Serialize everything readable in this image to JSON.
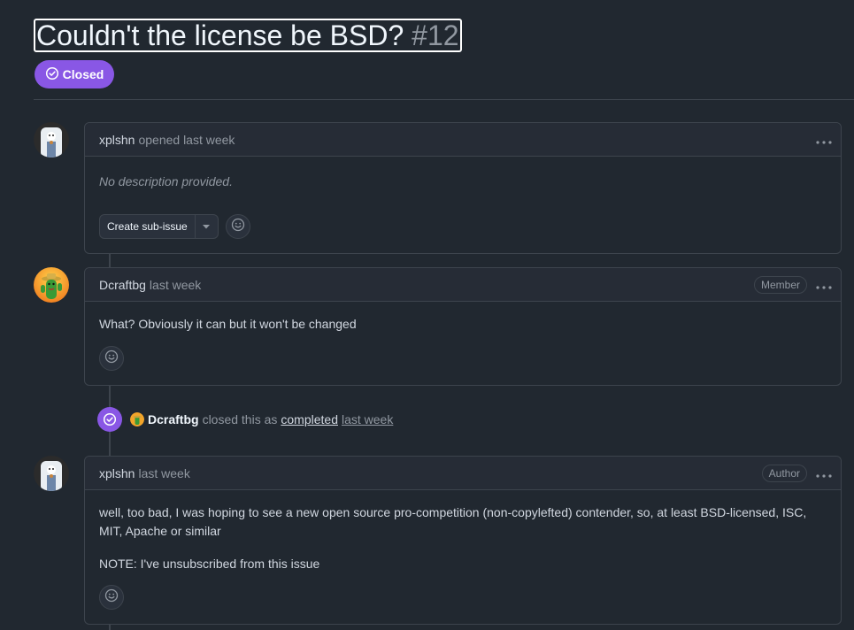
{
  "issue": {
    "title": "Couldn't the license be BSD?",
    "number": "#12",
    "state": "Closed",
    "state_color": "#8957e5"
  },
  "comments": [
    {
      "author": "xplshn",
      "meta": "opened last week",
      "role": "",
      "body": [
        "No description provided."
      ],
      "sub_issue_label": "Create sub-issue"
    },
    {
      "author": "Dcraftbg",
      "meta": "last week",
      "role": "Member",
      "body": [
        "What? Obviously it can but it won't be changed"
      ]
    },
    {
      "author": "xplshn",
      "meta": "last week",
      "role": "Author",
      "body": [
        "well, too bad, I was hoping to see a new open source pro-competition (non-copylefted) contender, so, at least BSD-licensed, ISC, MIT, Apache or similar",
        "NOTE: I've unsubscribed from this issue"
      ]
    }
  ],
  "event": {
    "actor": "Dcraftbg",
    "text": "closed this as",
    "reason": "completed",
    "time": "last week"
  },
  "icons": {
    "state": "circle-check-icon",
    "more": "kebab-icon",
    "reaction": "smiley-icon",
    "dropdown": "triangle-down-icon"
  }
}
